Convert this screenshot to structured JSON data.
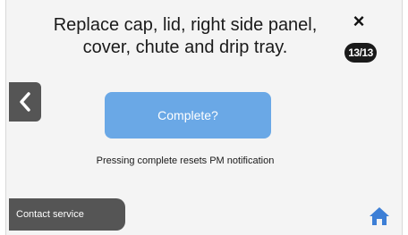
{
  "instruction": {
    "text": "Replace cap, lid, right side panel, cover, chute and drip tray."
  },
  "header": {
    "close_icon": "close-icon",
    "close_glyph": "×",
    "step_indicator": "13/13"
  },
  "navigation": {
    "back_icon": "chevron-left-icon"
  },
  "actions": {
    "complete_label": "Complete?",
    "helper_text": "Pressing complete resets PM notification",
    "contact_label": "Contact service"
  },
  "footer": {
    "home_icon": "home-icon"
  },
  "colors": {
    "background": "#f4f4f4",
    "accent": "#6aa8e6",
    "dark_button": "#555555",
    "home_icon": "#3d7fd6",
    "badge": "#1a1a1a"
  }
}
